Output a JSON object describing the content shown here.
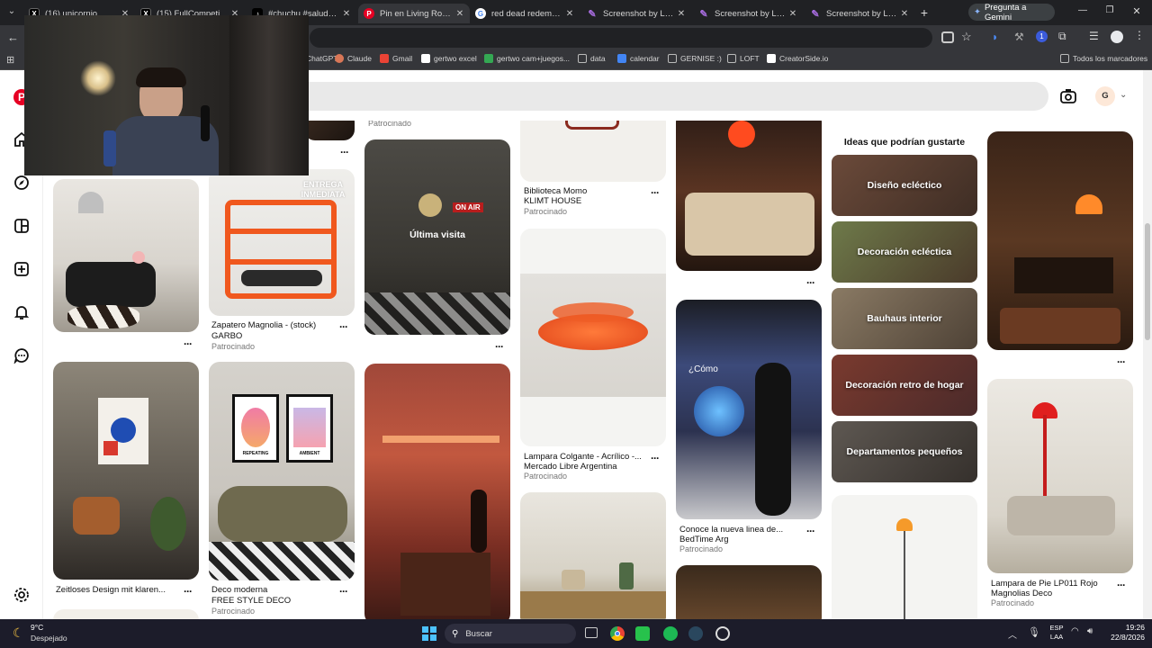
{
  "browser": {
    "tabs": [
      {
        "label": "(16) unicornio 🦄 (@",
        "icon": "x-logo-icon"
      },
      {
        "label": "(15) FullCompeti en X",
        "icon": "x-logo-icon"
      },
      {
        "label": "#chuchu #saludostik",
        "icon": "tiktok-icon"
      },
      {
        "label": "Pin en Living Room D",
        "icon": "pinterest-icon"
      },
      {
        "label": "red dead redemption",
        "icon": "google-icon"
      },
      {
        "label": "Screenshot by Lightsh",
        "icon": "feather-icon"
      },
      {
        "label": "Screenshot by Lightsh",
        "icon": "feather-icon"
      },
      {
        "label": "Screenshot by Lightsh",
        "icon": "feather-icon"
      }
    ],
    "new_tab": "+",
    "gemini_button": "Pregunta a Gemini",
    "profile_initial": "",
    "bookmarks": [
      {
        "label": "ChatGPT",
        "color": "#74aa9c"
      },
      {
        "label": "Claude",
        "color": "#d97757"
      },
      {
        "label": "Gmail",
        "color": "#ea4335"
      },
      {
        "label": "gertwo excel",
        "color": "#ffffff"
      },
      {
        "label": "gertwo cam+juegos...",
        "color": "#34a853"
      },
      {
        "label": "data",
        "color": "#9aa0a6"
      },
      {
        "label": "calendar",
        "color": "#4285f4"
      },
      {
        "label": "GERNISE :)",
        "color": "#9aa0a6"
      },
      {
        "label": "LOFT",
        "color": "#9aa0a6"
      },
      {
        "label": "CreatorSide.io",
        "color": "#ffffff"
      }
    ],
    "all_bookmarks": "Todos los marcadores"
  },
  "pinterest": {
    "avatar_initial": "G",
    "rail": [
      "pinterest-logo-icon",
      "home-icon",
      "explore-icon",
      "boards-icon",
      "create-icon",
      "notifications-icon",
      "messages-icon",
      "settings-icon"
    ],
    "ideas_title": "Ideas que podrían gustarte",
    "ideas": [
      "Diseño ecléctico",
      "Decoración ecléctica",
      "Bauhaus interior",
      "Decoración retro de hogar",
      "Departamentos pequeños"
    ],
    "pins": {
      "c1_top": {},
      "c1_mid": {},
      "c1_bot": {
        "title": "Zeitloses Design mit klaren..."
      },
      "c2_top": {
        "title": "Zapatero Magnolia - (stock)",
        "sub": "GARBO",
        "spon": "Patrocinado",
        "badge": "ENTREGA INMEDIATA"
      },
      "c2_bot": {
        "title": "Deco moderna",
        "sub": "FREE STYLE DECO",
        "spon": "Patrocinado",
        "art1": "REPEATING",
        "art2": "AMBIENT"
      },
      "c3_above": {
        "spon": "Patrocinado"
      },
      "c3_top": {
        "overlay": "Última visita",
        "sign": "ON AIR"
      },
      "c4_top": {
        "title": "Biblioteca Momo",
        "sub": "KLIMT HOUSE",
        "spon": "Patrocinado"
      },
      "c4_mid": {
        "title": "Lampara Colgante - Acrílico -...",
        "sub": "Mercado Libre Argentina",
        "spon": "Patrocinado"
      },
      "c5_mid": {
        "title": "Conoce la nueva linea de...",
        "sub": "BedTime Arg",
        "spon": "Patrocinado",
        "video_caption": "¿Cómo"
      },
      "c7_bot": {
        "title": "Lampara de Pie LP011 Rojo",
        "sub": "Magnolias Deco",
        "spon": "Patrocinado"
      }
    }
  },
  "taskbar": {
    "weather_temp": "9°C",
    "weather_desc": "Despejado",
    "search_placeholder": "Buscar",
    "lang_top": "ESP",
    "lang_bottom": "LAA",
    "time": "19:26",
    "date": "22/8/2026"
  }
}
